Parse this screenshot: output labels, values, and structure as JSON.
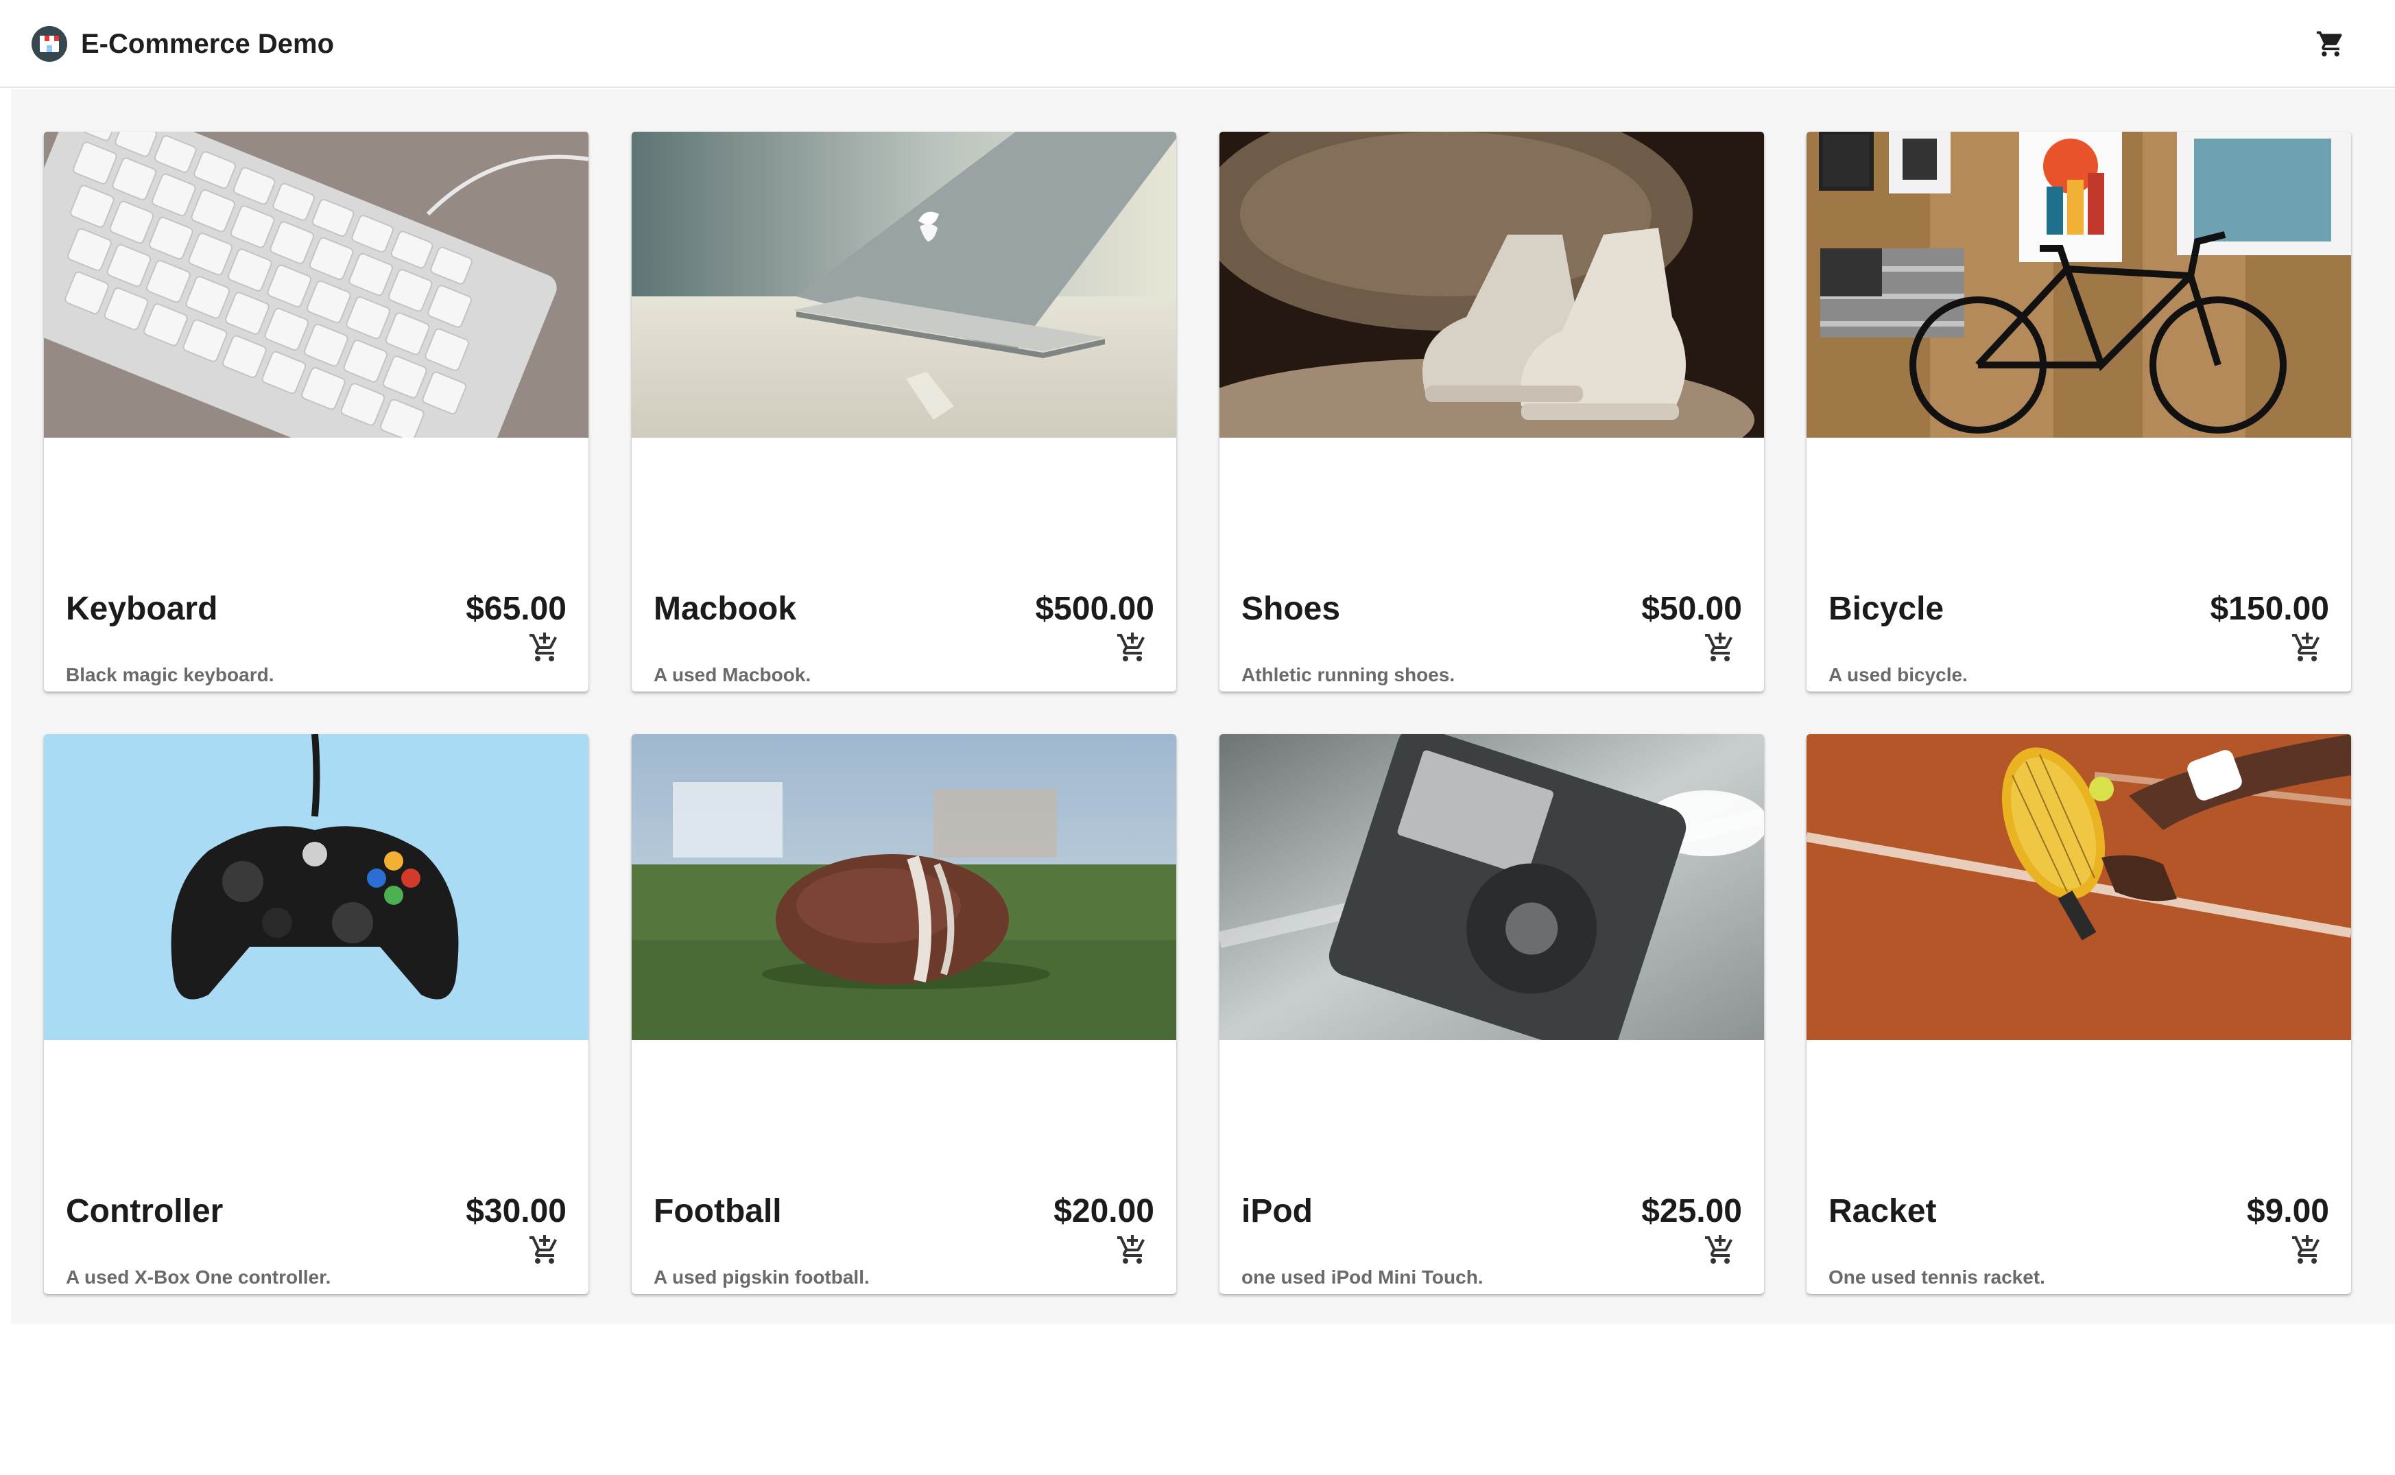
{
  "app": {
    "title": "E-Commerce Demo",
    "logo_icon": "shop-logo-icon",
    "cart_icon": "shopping-cart-icon"
  },
  "products": [
    {
      "name": "Keyboard",
      "price": "$65.00",
      "description": "Black magic keyboard.",
      "image": "keyboard-photo"
    },
    {
      "name": "Macbook",
      "price": "$500.00",
      "description": "A used Macbook.",
      "image": "macbook-photo"
    },
    {
      "name": "Shoes",
      "price": "$50.00",
      "description": "Athletic running shoes.",
      "image": "shoes-photo"
    },
    {
      "name": "Bicycle",
      "price": "$150.00",
      "description": "A used bicycle.",
      "image": "bicycle-photo"
    },
    {
      "name": "Controller",
      "price": "$30.00",
      "description": "A used X-Box One controller.",
      "image": "controller-photo"
    },
    {
      "name": "Football",
      "price": "$20.00",
      "description": "A used pigskin football.",
      "image": "football-photo"
    },
    {
      "name": "iPod",
      "price": "$25.00",
      "description": "one used iPod Mini Touch.",
      "image": "ipod-photo"
    },
    {
      "name": "Racket",
      "price": "$9.00",
      "description": "One used tennis racket.",
      "image": "racket-photo"
    }
  ],
  "add_to_cart_icon": "add-shopping-cart-icon",
  "colors": {
    "background": "#f5f5f5",
    "card": "#ffffff",
    "text": "#1b1b1b",
    "muted_text": "#6a6a6a"
  }
}
